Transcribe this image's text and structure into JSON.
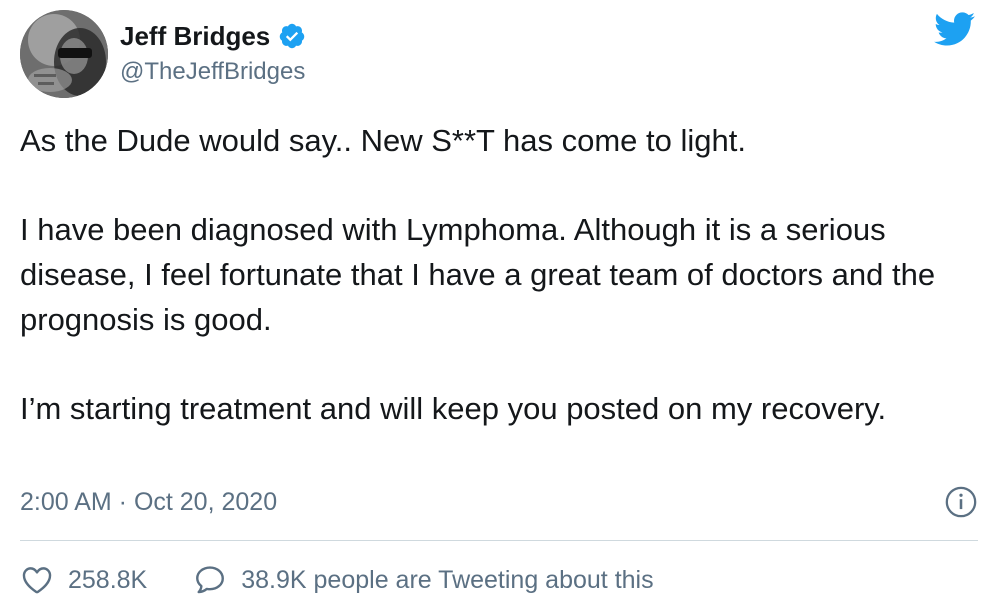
{
  "author": {
    "display_name": "Jeff Bridges",
    "handle": "@TheJeffBridges",
    "verified_icon": "verified-badge-icon",
    "avatar_icon": "avatar-photo"
  },
  "brand": {
    "logo_icon": "twitter-bird-icon",
    "accent_color": "#1da1f2"
  },
  "tweet": {
    "paragraphs": [
      "As the Dude would say.. New S**T has come to light.",
      "I have been diagnosed with Lymphoma. Although it is a serious disease, I feel fortunate that I have a great team of doctors and the prognosis is good.",
      "I’m starting treatment and will keep you posted on my recovery."
    ],
    "timestamp": "2:00 AM · Oct 20, 2020",
    "info_icon": "info-icon"
  },
  "actions": {
    "likes": {
      "icon": "heart-icon",
      "count": "258.8K"
    },
    "replies": {
      "icon": "speech-bubble-icon",
      "label": "38.9K people are Tweeting about this"
    }
  },
  "colors": {
    "text": "#14171a",
    "secondary": "#5b7083",
    "divider": "#cfd9de"
  }
}
